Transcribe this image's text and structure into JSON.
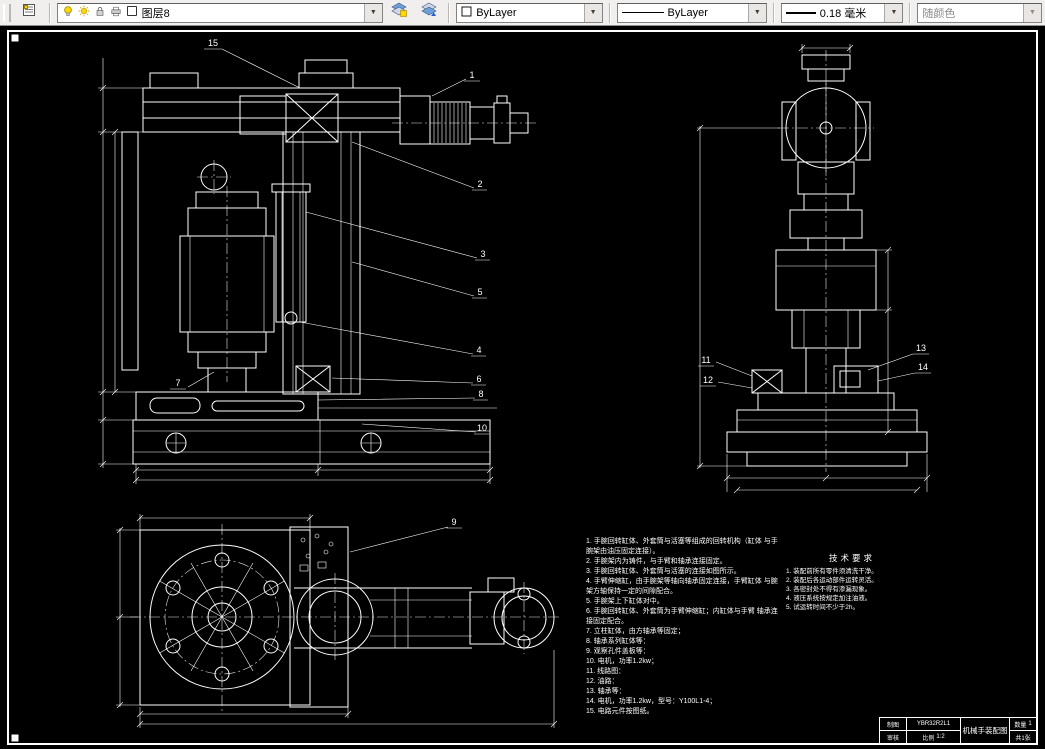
{
  "toolbar": {
    "layer_label": "图层8",
    "color_label": "ByLayer",
    "linetype_label": "ByLayer",
    "lineweight_label": "0.18 毫米",
    "plot_style_label": "随颜色",
    "dropdown_glyph": "▼"
  },
  "drawing": {
    "callouts": {
      "n1": "1",
      "n2": "2",
      "n3": "3",
      "n4": "4",
      "n5": "5",
      "n6": "6",
      "n7": "7",
      "n8": "8",
      "n9": "9",
      "n10": "10",
      "n11": "11",
      "n12": "12",
      "n13": "13",
      "n14": "14",
      "n15": "15"
    },
    "notes": [
      "1. 手腕回转缸体、外套筒与活塞等组成的回转机构（缸体 与手腕架由油压固定连接）。",
      "2. 手腕架内为铸件，与手臂和轴承连接固定。",
      "3. 手腕回转缸体、外套筒与活塞的连接如图所示。",
      "4. 手臂伸缩缸，由手腕架等轴向轴承固定连接，手臂缸体 与腕架方轴保持一定的间隙配合。",
      "5. 手腕架上下缸体对中。",
      "6. 手腕回转缸体、外套筒为手臂伸缩缸；内缸体与手臂 轴承连接固定配合。",
      "7. 立柱缸体，由方轴承等固定；",
      "8. 轴承系列缸体等：",
      "9. 观察孔件盖板等：",
      "10. 电机，功率1.2kw；",
      "11. 线路图：",
      "12. 油路：",
      "13. 轴承等：",
      "14. 电机，功率1.2kw，型号：Y100L1-4；",
      "15. 电路元件按图纸。"
    ],
    "tech_req": {
      "title": "技术要求",
      "lines": [
        "1. 装配前所有零件须清洗干净。",
        "2. 装配后各运动部件运转灵活。",
        "3. 各密封处不得有渗漏现象。",
        "4. 液压系统按规定加注油液。",
        "5. 试运转时间不少于2h。"
      ]
    },
    "title_block": {
      "maker_label": "制图",
      "checker_label": "审核",
      "drawing_no": "YBR32R2L1",
      "title": "机械手装配图",
      "scale_label": "比例",
      "scale": "1:2",
      "qty_label": "数量",
      "qty": "1",
      "sheet_label": "共1张"
    }
  }
}
